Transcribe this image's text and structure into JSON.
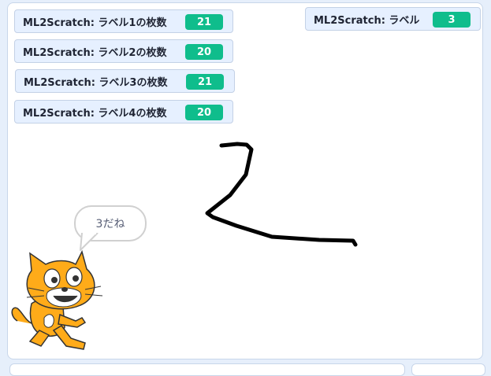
{
  "monitors": [
    {
      "label": "ML2Scratch: ラベル1の枚数",
      "value": "21"
    },
    {
      "label": "ML2Scratch: ラベル2の枚数",
      "value": "20"
    },
    {
      "label": "ML2Scratch: ラベル3の枚数",
      "value": "21"
    },
    {
      "label": "ML2Scratch: ラベル4の枚数",
      "value": "20"
    }
  ],
  "label_monitor": {
    "label": "ML2Scratch: ラベル",
    "value": "3"
  },
  "speech_bubble": {
    "text": "3だね"
  },
  "sprite": {
    "icon": "scratch-cat-sprite"
  },
  "colors": {
    "monitor_value_bg": "#0fbd8c",
    "monitor_bg": "#e6f0ff",
    "pen": "#000000"
  }
}
